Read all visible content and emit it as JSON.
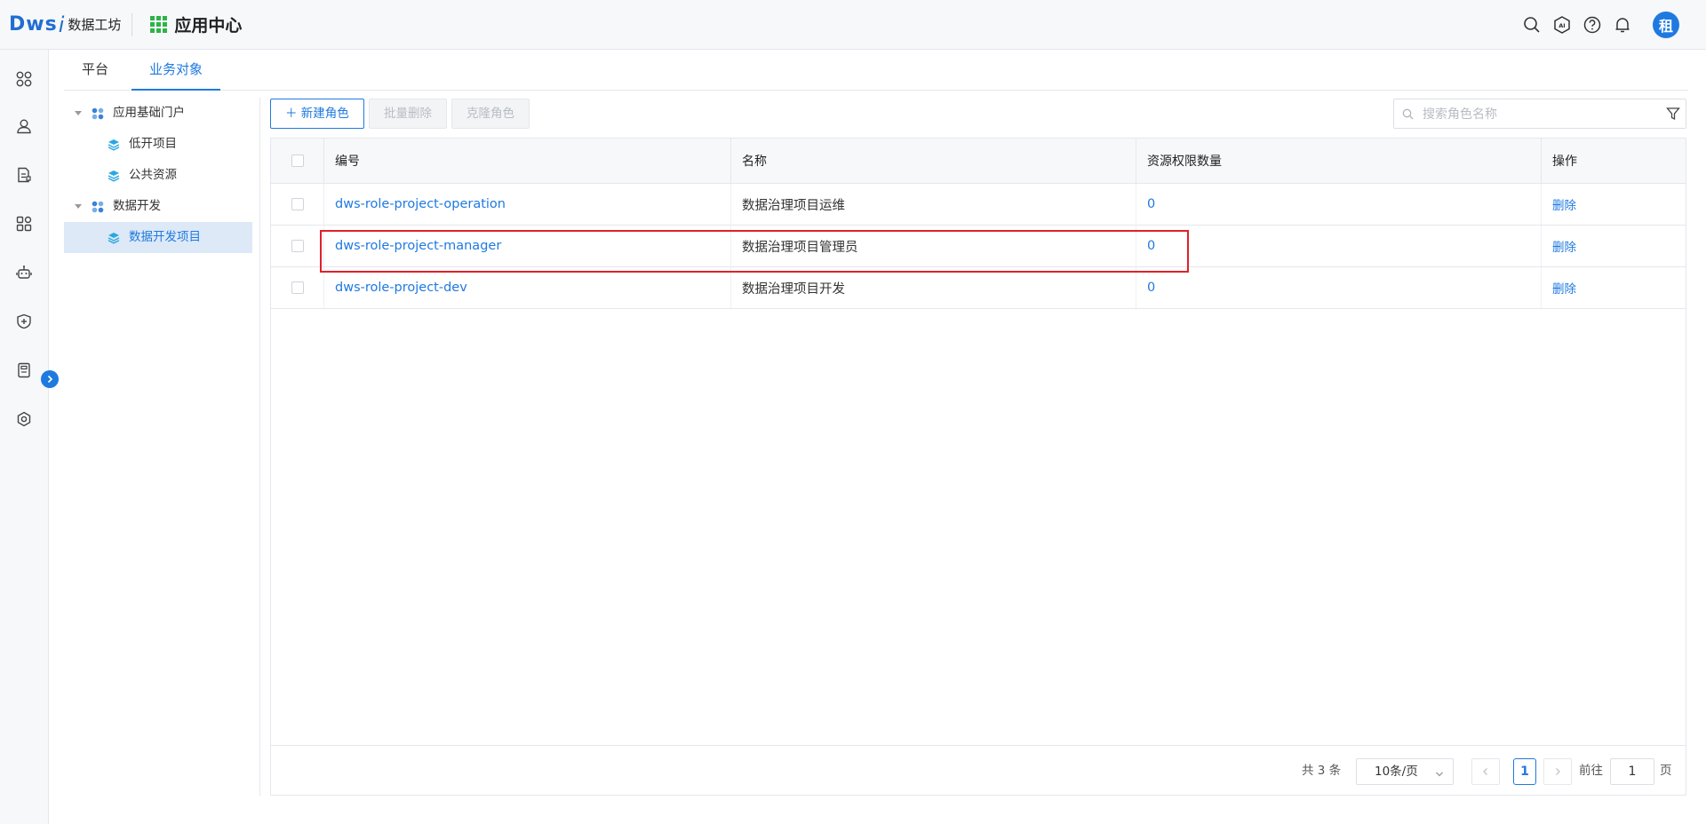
{
  "header": {
    "logo_text": "Dws",
    "logo_i": "i",
    "logo_sub": "数据工坊",
    "app_title": "应用中心",
    "avatar_text": "租"
  },
  "tabs": [
    {
      "label": "平台",
      "active": false
    },
    {
      "label": "业务对象",
      "active": true
    }
  ],
  "tree": [
    {
      "label": "应用基础门户",
      "level": 1
    },
    {
      "label": "低开项目",
      "level": 2
    },
    {
      "label": "公共资源",
      "level": 2
    },
    {
      "label": "数据开发",
      "level": 1
    },
    {
      "label": "数据开发项目",
      "level": 2,
      "selected": true
    }
  ],
  "toolbar": {
    "new_role": "新建角色",
    "batch_delete": "批量删除",
    "clone_role": "克隆角色",
    "search_placeholder": "搜索角色名称"
  },
  "table": {
    "columns": [
      "编号",
      "名称",
      "资源权限数量",
      "操作"
    ],
    "rows": [
      {
        "code": "dws-role-project-operation",
        "name": "数据治理项目运维",
        "count": "0",
        "op": "删除"
      },
      {
        "code": "dws-role-project-manager",
        "name": "数据治理项目管理员",
        "count": "0",
        "op": "删除"
      },
      {
        "code": "dws-role-project-dev",
        "name": "数据治理项目开发",
        "count": "0",
        "op": "删除"
      }
    ]
  },
  "pagination": {
    "total": "共 3 条",
    "page_size": "10条/页",
    "current": "1",
    "goto_label": "前往",
    "goto_value": "1",
    "page_label": "页"
  },
  "colors": {
    "accent": "#1f7ae0",
    "highlight": "#e0202b",
    "app_icon": "#2db34a"
  }
}
